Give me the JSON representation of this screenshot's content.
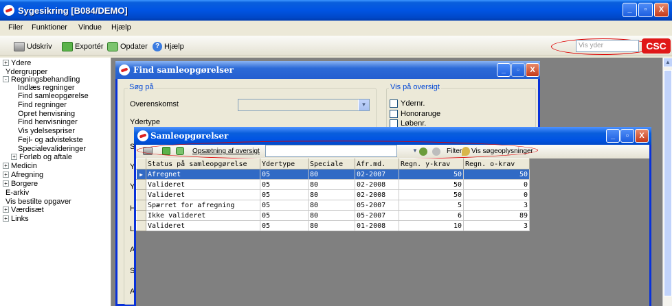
{
  "main_window": {
    "title": "Sygesikring [B084/DEMO]",
    "controls": {
      "minimize": "_",
      "maximize": "▫",
      "close": "X"
    }
  },
  "menu": [
    "Filer",
    "Funktioner",
    "Vindue",
    "Hjælp"
  ],
  "toolbar": {
    "print_label": "Udskriv",
    "export_label": "Exportér",
    "update_label": "Opdater",
    "help_label": "Hjælp",
    "search_placeholder": "Vis yder",
    "logo": "CSC"
  },
  "tree": [
    {
      "label": "Ydere",
      "expander": "+"
    },
    {
      "label": "Ydergrupper",
      "expander": ""
    },
    {
      "label": "Regningsbehandling",
      "expander": "-"
    },
    {
      "label": "Indlæs regninger",
      "expander": ""
    },
    {
      "label": "Find samleopgørelse",
      "expander": ""
    },
    {
      "label": "Find regninger",
      "expander": ""
    },
    {
      "label": "Opret henvisning",
      "expander": ""
    },
    {
      "label": "Find henvisninger",
      "expander": ""
    },
    {
      "label": "Vis ydelsespriser",
      "expander": ""
    },
    {
      "label": "Fejl- og advistekste",
      "expander": ""
    },
    {
      "label": "Specialevalideringer",
      "expander": ""
    },
    {
      "label": "Forløb og aftale",
      "expander": "+"
    },
    {
      "label": "Medicin",
      "expander": "+"
    },
    {
      "label": "Afregning",
      "expander": "+"
    },
    {
      "label": "Borgere",
      "expander": "+"
    },
    {
      "label": "E-arkiv",
      "expander": ""
    },
    {
      "label": "Vis bestilte opgaver",
      "expander": ""
    },
    {
      "label": "Værdisæt",
      "expander": "+"
    },
    {
      "label": "Links",
      "expander": "+"
    }
  ],
  "find_window": {
    "title": "Find samleopgørelser",
    "search_group": "Søg på",
    "overenskomst_label": "Overenskomst",
    "ydertype_label": "Ydertype",
    "partial_labels": [
      "S",
      "Y",
      "Y",
      "H",
      "L",
      "A",
      "S",
      "A"
    ],
    "show_group": "Vis på oversigt",
    "checkboxes": [
      "Ydernr.",
      "Honoraruge",
      "Løbenr."
    ]
  },
  "saml_window": {
    "title": "Samleopgørelser",
    "setup_label": "Opsætning af oversigt",
    "filter_label": "Filter",
    "search_info_label": "Vis søgeoplysninger",
    "columns": [
      "Status på samleopgørelse",
      "Ydertype",
      "Speciale",
      "Afr.md.",
      "Regn. y-krav",
      "Regn. o-krav"
    ],
    "rows": [
      [
        "Afregnet",
        "05",
        "80",
        "02-2007",
        "50",
        "50"
      ],
      [
        "Valideret",
        "05",
        "80",
        "02-2008",
        "50",
        "0"
      ],
      [
        "Valideret",
        "05",
        "80",
        "02-2008",
        "50",
        "0"
      ],
      [
        "Spærret for afregning",
        "05",
        "80",
        "05-2007",
        "5",
        "3"
      ],
      [
        "Ikke valideret",
        "05",
        "80",
        "05-2007",
        "6",
        "89"
      ],
      [
        "Valideret",
        "05",
        "80",
        "01-2008",
        "10",
        "3"
      ]
    ],
    "selected_row": 0
  }
}
